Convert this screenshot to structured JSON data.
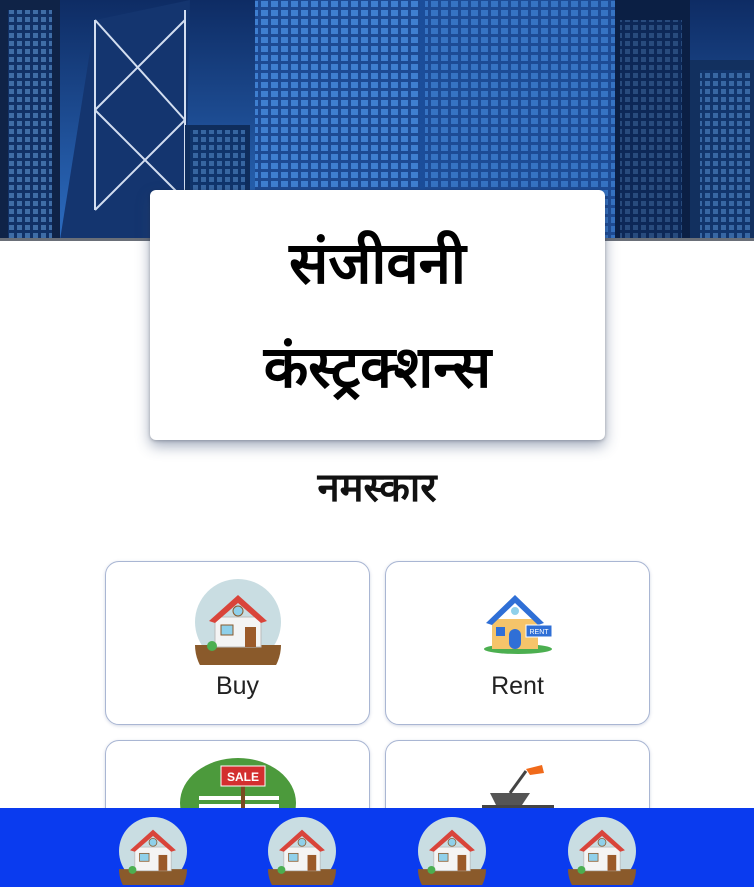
{
  "hero": {
    "image": "city-skyscrapers-photo"
  },
  "title": {
    "line1": "संजीवनी",
    "line2": "कंस्ट्रक्शन्स"
  },
  "greeting": "नमस्कार",
  "services": [
    {
      "label": "Buy",
      "icon": "house-circle-icon"
    },
    {
      "label": "Rent",
      "icon": "house-rent-icon"
    },
    {
      "label": "",
      "icon": "sale-sign-icon",
      "sign_text": "SALE"
    },
    {
      "label": "",
      "icon": "trowel-bricks-icon"
    }
  ],
  "bottom_nav": {
    "background": "#0a3bef",
    "items": [
      "house-circle-icon",
      "house-circle-icon",
      "house-circle-icon",
      "house-circle-icon"
    ]
  },
  "colors": {
    "nav_blue": "#0a3bef",
    "card_border": "#a9b6d3"
  }
}
